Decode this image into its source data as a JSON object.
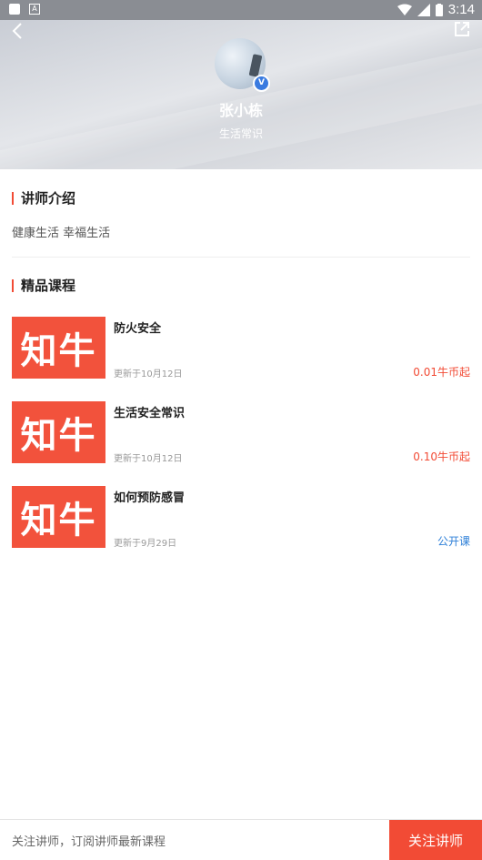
{
  "status": {
    "time": "3:14"
  },
  "profile": {
    "name": "张小栋",
    "subtitle": "生活常识"
  },
  "intro": {
    "heading": "讲师介绍",
    "text": "健康生活 幸福生活"
  },
  "courses_section": {
    "heading": "精品课程"
  },
  "courses": [
    {
      "thumb": "知牛",
      "title": "防火安全",
      "date": "更新于10月12日",
      "price": "0.01牛币起",
      "price_color": "#f24b35"
    },
    {
      "thumb": "知牛",
      "title": "生活安全常识",
      "date": "更新于10月12日",
      "price": "0.10牛币起",
      "price_color": "#f24b35"
    },
    {
      "thumb": "知牛",
      "title": "如何预防感冒",
      "date": "更新于9月29日",
      "price": "公开课",
      "price_color": "#2f80d8"
    }
  ],
  "bottom": {
    "hint": "关注讲师，订阅讲师最新课程",
    "follow_label": "关注讲师"
  },
  "colors": {
    "accent": "#f24b35",
    "link": "#2f80d8"
  }
}
